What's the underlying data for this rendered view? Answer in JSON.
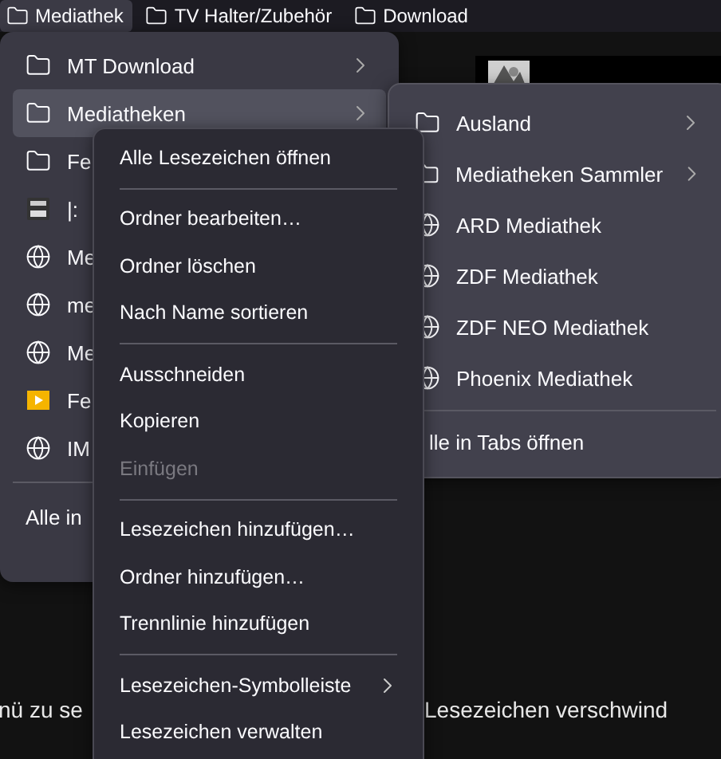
{
  "toolbar": [
    {
      "label": "Mediathek",
      "selected": true
    },
    {
      "label": "TV Halter/Zubehör",
      "selected": false
    },
    {
      "label": "Download",
      "selected": false
    }
  ],
  "bookmarks_menu": {
    "items": [
      {
        "kind": "folder",
        "label": "MT Download",
        "submenu": true,
        "selected": false
      },
      {
        "kind": "folder",
        "label": "Mediatheken",
        "submenu": true,
        "selected": true
      },
      {
        "kind": "folder",
        "label": "Fe",
        "selected": false
      },
      {
        "kind": "video",
        "label": "|:",
        "selected": false
      },
      {
        "kind": "globe",
        "label": "Me",
        "selected": false
      },
      {
        "kind": "globe",
        "label": "me",
        "selected": false
      },
      {
        "kind": "globe",
        "label": "Me",
        "selected": false
      },
      {
        "kind": "play",
        "label": "Fe",
        "selected": false
      },
      {
        "kind": "globe",
        "label": "IM",
        "selected": false
      }
    ],
    "footer": "Alle in"
  },
  "submenu": {
    "items": [
      {
        "kind": "folder",
        "label": "Ausland",
        "submenu": true
      },
      {
        "kind": "folder",
        "label": "Mediatheken Sammler",
        "submenu": true
      },
      {
        "kind": "globe",
        "label": "ARD Mediathek",
        "submenu": false
      },
      {
        "kind": "globe",
        "label": "ZDF Mediathek",
        "submenu": false
      },
      {
        "kind": "globe",
        "label": "ZDF NEO Mediathek",
        "submenu": false
      },
      {
        "kind": "globe",
        "label": "Phoenix Mediathek",
        "submenu": false
      }
    ],
    "footer": "lle in Tabs öffnen"
  },
  "context_menu": {
    "groups": [
      [
        {
          "label": "Alle Lesezeichen öffnen",
          "disabled": false,
          "submenu": false
        }
      ],
      [
        {
          "label": "Ordner bearbeiten…",
          "disabled": false,
          "submenu": false
        },
        {
          "label": "Ordner löschen",
          "disabled": false,
          "submenu": false
        },
        {
          "label": "Nach Name sortieren",
          "disabled": false,
          "submenu": false
        }
      ],
      [
        {
          "label": "Ausschneiden",
          "disabled": false,
          "submenu": false
        },
        {
          "label": "Kopieren",
          "disabled": false,
          "submenu": false
        },
        {
          "label": "Einfügen",
          "disabled": true,
          "submenu": false
        }
      ],
      [
        {
          "label": "Lesezeichen hinzufügen…",
          "disabled": false,
          "submenu": false
        },
        {
          "label": "Ordner hinzufügen…",
          "disabled": false,
          "submenu": false
        },
        {
          "label": "Trennlinie hinzufügen",
          "disabled": false,
          "submenu": false
        }
      ],
      [
        {
          "label": "Lesezeichen-Symbolleiste",
          "disabled": false,
          "submenu": true
        },
        {
          "label": "Lesezeichen verwalten",
          "disabled": false,
          "submenu": false
        }
      ]
    ]
  },
  "page_text": {
    "left": "nü zu se",
    "right": "Lesezeichen verschwind"
  }
}
